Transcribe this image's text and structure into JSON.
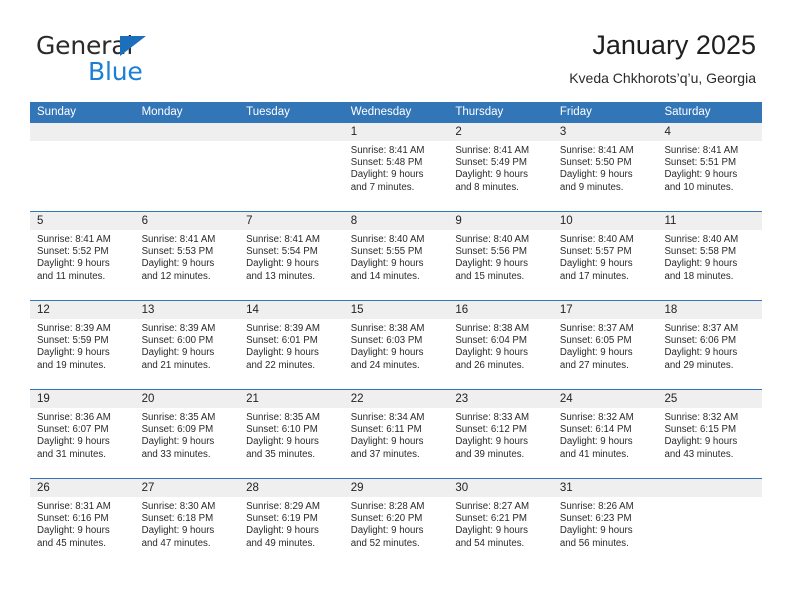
{
  "brand": {
    "name_part1": "General",
    "name_part2": "Blue",
    "triangle_icon": "triangle-logo-icon",
    "accent_blue": "#1c7fd6",
    "triangle_blue": "#1c6fba"
  },
  "header": {
    "title": "January 2025",
    "subtitle": "Kveda Chkhorots’q’u, Georgia"
  },
  "colors": {
    "header_row_blue": "#3376b7",
    "day_strip_gray": "#efefef",
    "text_dark": "#2a2a2a",
    "row_separator": "#3376b7"
  },
  "weekdays": [
    "Sunday",
    "Monday",
    "Tuesday",
    "Wednesday",
    "Thursday",
    "Friday",
    "Saturday"
  ],
  "weeks": [
    [
      {
        "day": "",
        "empty": true,
        "sunrise": "",
        "sunset": "",
        "daylight_line1": "",
        "daylight_line2": ""
      },
      {
        "day": "",
        "empty": true,
        "sunrise": "",
        "sunset": "",
        "daylight_line1": "",
        "daylight_line2": ""
      },
      {
        "day": "",
        "empty": true,
        "sunrise": "",
        "sunset": "",
        "daylight_line1": "",
        "daylight_line2": ""
      },
      {
        "day": "1",
        "empty": false,
        "sunrise": "Sunrise: 8:41 AM",
        "sunset": "Sunset: 5:48 PM",
        "daylight_line1": "Daylight: 9 hours",
        "daylight_line2": "and 7 minutes."
      },
      {
        "day": "2",
        "empty": false,
        "sunrise": "Sunrise: 8:41 AM",
        "sunset": "Sunset: 5:49 PM",
        "daylight_line1": "Daylight: 9 hours",
        "daylight_line2": "and 8 minutes."
      },
      {
        "day": "3",
        "empty": false,
        "sunrise": "Sunrise: 8:41 AM",
        "sunset": "Sunset: 5:50 PM",
        "daylight_line1": "Daylight: 9 hours",
        "daylight_line2": "and 9 minutes."
      },
      {
        "day": "4",
        "empty": false,
        "sunrise": "Sunrise: 8:41 AM",
        "sunset": "Sunset: 5:51 PM",
        "daylight_line1": "Daylight: 9 hours",
        "daylight_line2": "and 10 minutes."
      }
    ],
    [
      {
        "day": "5",
        "empty": false,
        "sunrise": "Sunrise: 8:41 AM",
        "sunset": "Sunset: 5:52 PM",
        "daylight_line1": "Daylight: 9 hours",
        "daylight_line2": "and 11 minutes."
      },
      {
        "day": "6",
        "empty": false,
        "sunrise": "Sunrise: 8:41 AM",
        "sunset": "Sunset: 5:53 PM",
        "daylight_line1": "Daylight: 9 hours",
        "daylight_line2": "and 12 minutes."
      },
      {
        "day": "7",
        "empty": false,
        "sunrise": "Sunrise: 8:41 AM",
        "sunset": "Sunset: 5:54 PM",
        "daylight_line1": "Daylight: 9 hours",
        "daylight_line2": "and 13 minutes."
      },
      {
        "day": "8",
        "empty": false,
        "sunrise": "Sunrise: 8:40 AM",
        "sunset": "Sunset: 5:55 PM",
        "daylight_line1": "Daylight: 9 hours",
        "daylight_line2": "and 14 minutes."
      },
      {
        "day": "9",
        "empty": false,
        "sunrise": "Sunrise: 8:40 AM",
        "sunset": "Sunset: 5:56 PM",
        "daylight_line1": "Daylight: 9 hours",
        "daylight_line2": "and 15 minutes."
      },
      {
        "day": "10",
        "empty": false,
        "sunrise": "Sunrise: 8:40 AM",
        "sunset": "Sunset: 5:57 PM",
        "daylight_line1": "Daylight: 9 hours",
        "daylight_line2": "and 17 minutes."
      },
      {
        "day": "11",
        "empty": false,
        "sunrise": "Sunrise: 8:40 AM",
        "sunset": "Sunset: 5:58 PM",
        "daylight_line1": "Daylight: 9 hours",
        "daylight_line2": "and 18 minutes."
      }
    ],
    [
      {
        "day": "12",
        "empty": false,
        "sunrise": "Sunrise: 8:39 AM",
        "sunset": "Sunset: 5:59 PM",
        "daylight_line1": "Daylight: 9 hours",
        "daylight_line2": "and 19 minutes."
      },
      {
        "day": "13",
        "empty": false,
        "sunrise": "Sunrise: 8:39 AM",
        "sunset": "Sunset: 6:00 PM",
        "daylight_line1": "Daylight: 9 hours",
        "daylight_line2": "and 21 minutes."
      },
      {
        "day": "14",
        "empty": false,
        "sunrise": "Sunrise: 8:39 AM",
        "sunset": "Sunset: 6:01 PM",
        "daylight_line1": "Daylight: 9 hours",
        "daylight_line2": "and 22 minutes."
      },
      {
        "day": "15",
        "empty": false,
        "sunrise": "Sunrise: 8:38 AM",
        "sunset": "Sunset: 6:03 PM",
        "daylight_line1": "Daylight: 9 hours",
        "daylight_line2": "and 24 minutes."
      },
      {
        "day": "16",
        "empty": false,
        "sunrise": "Sunrise: 8:38 AM",
        "sunset": "Sunset: 6:04 PM",
        "daylight_line1": "Daylight: 9 hours",
        "daylight_line2": "and 26 minutes."
      },
      {
        "day": "17",
        "empty": false,
        "sunrise": "Sunrise: 8:37 AM",
        "sunset": "Sunset: 6:05 PM",
        "daylight_line1": "Daylight: 9 hours",
        "daylight_line2": "and 27 minutes."
      },
      {
        "day": "18",
        "empty": false,
        "sunrise": "Sunrise: 8:37 AM",
        "sunset": "Sunset: 6:06 PM",
        "daylight_line1": "Daylight: 9 hours",
        "daylight_line2": "and 29 minutes."
      }
    ],
    [
      {
        "day": "19",
        "empty": false,
        "sunrise": "Sunrise: 8:36 AM",
        "sunset": "Sunset: 6:07 PM",
        "daylight_line1": "Daylight: 9 hours",
        "daylight_line2": "and 31 minutes."
      },
      {
        "day": "20",
        "empty": false,
        "sunrise": "Sunrise: 8:35 AM",
        "sunset": "Sunset: 6:09 PM",
        "daylight_line1": "Daylight: 9 hours",
        "daylight_line2": "and 33 minutes."
      },
      {
        "day": "21",
        "empty": false,
        "sunrise": "Sunrise: 8:35 AM",
        "sunset": "Sunset: 6:10 PM",
        "daylight_line1": "Daylight: 9 hours",
        "daylight_line2": "and 35 minutes."
      },
      {
        "day": "22",
        "empty": false,
        "sunrise": "Sunrise: 8:34 AM",
        "sunset": "Sunset: 6:11 PM",
        "daylight_line1": "Daylight: 9 hours",
        "daylight_line2": "and 37 minutes."
      },
      {
        "day": "23",
        "empty": false,
        "sunrise": "Sunrise: 8:33 AM",
        "sunset": "Sunset: 6:12 PM",
        "daylight_line1": "Daylight: 9 hours",
        "daylight_line2": "and 39 minutes."
      },
      {
        "day": "24",
        "empty": false,
        "sunrise": "Sunrise: 8:32 AM",
        "sunset": "Sunset: 6:14 PM",
        "daylight_line1": "Daylight: 9 hours",
        "daylight_line2": "and 41 minutes."
      },
      {
        "day": "25",
        "empty": false,
        "sunrise": "Sunrise: 8:32 AM",
        "sunset": "Sunset: 6:15 PM",
        "daylight_line1": "Daylight: 9 hours",
        "daylight_line2": "and 43 minutes."
      }
    ],
    [
      {
        "day": "26",
        "empty": false,
        "sunrise": "Sunrise: 8:31 AM",
        "sunset": "Sunset: 6:16 PM",
        "daylight_line1": "Daylight: 9 hours",
        "daylight_line2": "and 45 minutes."
      },
      {
        "day": "27",
        "empty": false,
        "sunrise": "Sunrise: 8:30 AM",
        "sunset": "Sunset: 6:18 PM",
        "daylight_line1": "Daylight: 9 hours",
        "daylight_line2": "and 47 minutes."
      },
      {
        "day": "28",
        "empty": false,
        "sunrise": "Sunrise: 8:29 AM",
        "sunset": "Sunset: 6:19 PM",
        "daylight_line1": "Daylight: 9 hours",
        "daylight_line2": "and 49 minutes."
      },
      {
        "day": "29",
        "empty": false,
        "sunrise": "Sunrise: 8:28 AM",
        "sunset": "Sunset: 6:20 PM",
        "daylight_line1": "Daylight: 9 hours",
        "daylight_line2": "and 52 minutes."
      },
      {
        "day": "30",
        "empty": false,
        "sunrise": "Sunrise: 8:27 AM",
        "sunset": "Sunset: 6:21 PM",
        "daylight_line1": "Daylight: 9 hours",
        "daylight_line2": "and 54 minutes."
      },
      {
        "day": "31",
        "empty": false,
        "sunrise": "Sunrise: 8:26 AM",
        "sunset": "Sunset: 6:23 PM",
        "daylight_line1": "Daylight: 9 hours",
        "daylight_line2": "and 56 minutes."
      },
      {
        "day": "",
        "empty": true,
        "sunrise": "",
        "sunset": "",
        "daylight_line1": "",
        "daylight_line2": ""
      }
    ]
  ]
}
